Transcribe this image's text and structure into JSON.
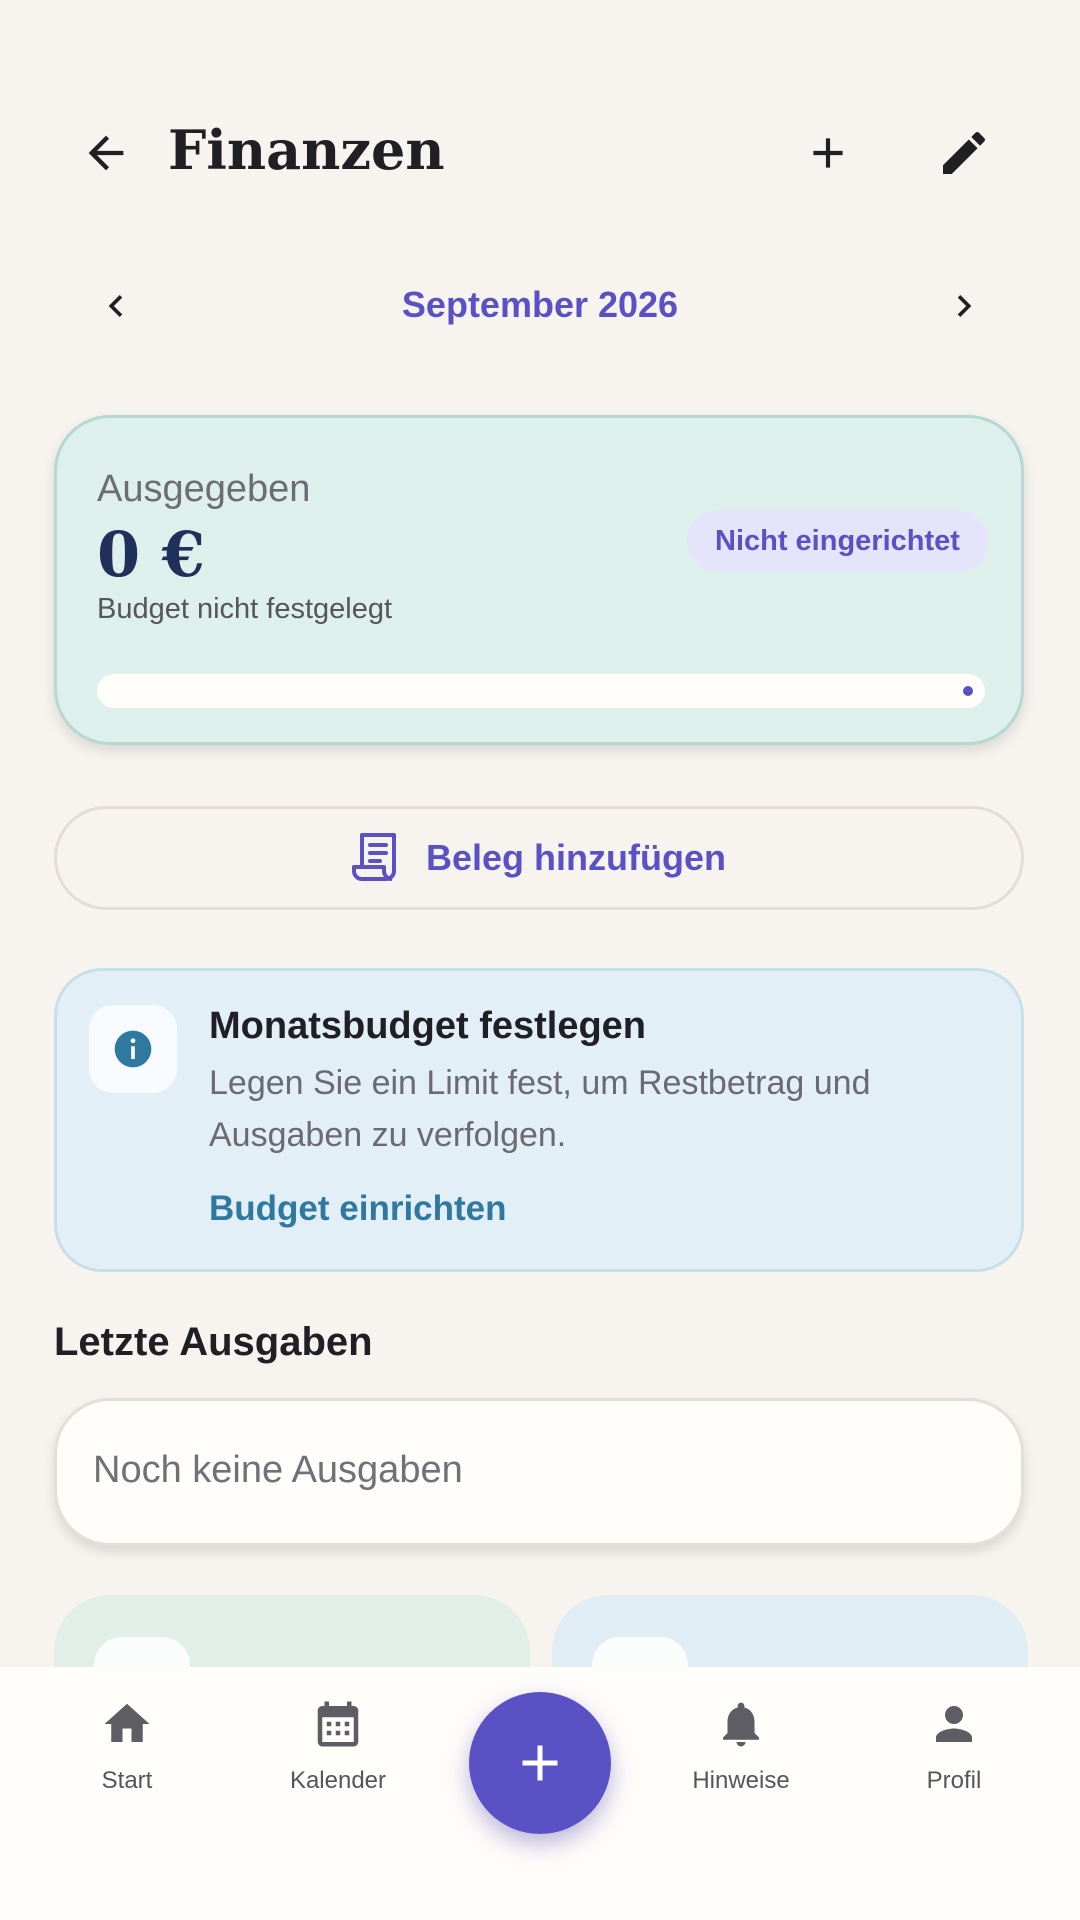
{
  "header": {
    "title": "Finanzen",
    "icons": {
      "back": "arrow-back-icon",
      "add": "plus-icon",
      "edit": "pencil-icon"
    }
  },
  "month_nav": {
    "label": "September 2026",
    "icons": {
      "prev": "chevron-left-icon",
      "next": "chevron-right-icon"
    }
  },
  "spent_card": {
    "label": "Ausgegeben",
    "amount": "0 €",
    "note": "Budget nicht festgelegt",
    "badge": "Nicht eingerichtet",
    "progress_fraction": 0
  },
  "receipt_button": {
    "label": "Beleg hinzufügen",
    "icon": "receipt-icon"
  },
  "info_card": {
    "icon": "info-icon",
    "title": "Monatsbudget festlegen",
    "body": "Legen Sie ein Limit fest, um Restbetrag und Ausgaben zu verfolgen.",
    "link": "Budget einrichten"
  },
  "recent": {
    "title": "Letzte Ausgaben",
    "empty_text": "Noch keine Ausgaben"
  },
  "bottom_nav": {
    "items": [
      {
        "label": "Start",
        "icon": "home-icon"
      },
      {
        "label": "Kalender",
        "icon": "calendar-icon"
      },
      {
        "label": "Hinweise",
        "icon": "bell-icon"
      },
      {
        "label": "Profil",
        "icon": "person-icon"
      }
    ],
    "fab_icon": "plus-icon"
  },
  "colors": {
    "accent": "#5a52c4",
    "background": "#f7f4f0",
    "spent_card_bg": "#def0ec",
    "info_card_bg": "#e2eff6",
    "link": "#2f78a0"
  }
}
